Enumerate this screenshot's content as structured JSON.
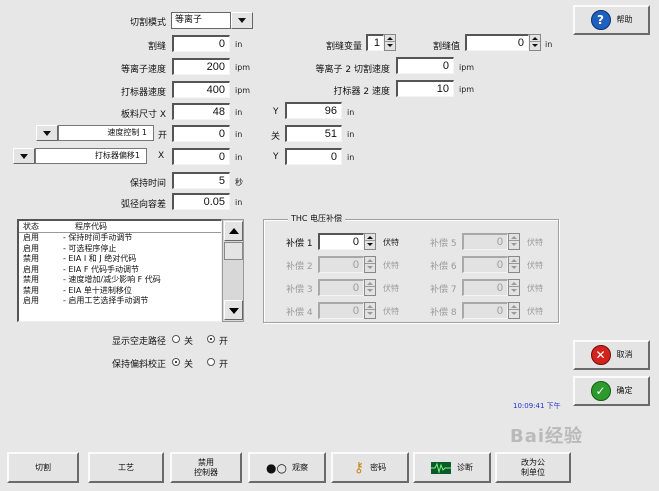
{
  "cut_mode": {
    "label": "切割模式",
    "value": "等离子"
  },
  "fields_left": [
    {
      "label": "割缝",
      "value": "0",
      "unit": "in"
    },
    {
      "label": "等离子速度",
      "value": "200",
      "unit": "ipm"
    },
    {
      "label": "打标器速度",
      "value": "400",
      "unit": "ipm"
    },
    {
      "label": "板料尺寸 X",
      "value": "48",
      "unit": "in"
    }
  ],
  "kerf_variable": {
    "label": "割缝变量",
    "value": "1"
  },
  "kerf_value": {
    "label": "割缝值",
    "value": "0",
    "unit": "in"
  },
  "plasma2_speed": {
    "label": "等离子 2 切割速度",
    "value": "0",
    "unit": "ipm"
  },
  "marker2_speed": {
    "label": "打标器 2 速度",
    "value": "10",
    "unit": "ipm"
  },
  "plate_y": {
    "label": "Y",
    "value": "96",
    "unit": "in"
  },
  "speed_control": {
    "label": "速度控制 1",
    "suffix": "开",
    "value": "0",
    "unit": "in",
    "right_label": "关",
    "right_value": "51",
    "right_unit": "in"
  },
  "marker_offset": {
    "label": "打标器偏移1",
    "axis": "X",
    "value": "0",
    "unit": "in",
    "right_label": "Y",
    "right_value": "0",
    "right_unit": "in"
  },
  "hold_time": {
    "label": "保持时间",
    "value": "5",
    "unit": "秒"
  },
  "arc_tolerance": {
    "label": "弧径向容差",
    "value": "0.05",
    "unit": "in"
  },
  "code_list": {
    "col_status": "状态",
    "col_code": "程序代码",
    "rows": [
      {
        "status": "启用",
        "code": "- 保持时间手动调节"
      },
      {
        "status": "启用",
        "code": "- 可选程序停止"
      },
      {
        "status": "禁用",
        "code": "- EIA I 和 J 绝对代码"
      },
      {
        "status": "启用",
        "code": "- EIA F 代码手动调节"
      },
      {
        "status": "禁用",
        "code": "- 速度增加/减少影响 F 代码"
      },
      {
        "status": "禁用",
        "code": "- EIA 单十进制移位"
      },
      {
        "status": "启用",
        "code": "- 启用工艺选择手动调节"
      }
    ]
  },
  "thc": {
    "title": "THC 电压补偿",
    "unit": "伏特",
    "items": [
      {
        "label": "补偿 1",
        "value": "0"
      },
      {
        "label": "补偿 2",
        "value": "0"
      },
      {
        "label": "补偿 3",
        "value": "0"
      },
      {
        "label": "补偿 4",
        "value": "0"
      },
      {
        "label": "补偿 5",
        "value": "0"
      },
      {
        "label": "补偿 6",
        "value": "0"
      },
      {
        "label": "补偿 7",
        "value": "0"
      },
      {
        "label": "补偿 8",
        "value": "0"
      }
    ]
  },
  "show_dry_path": {
    "label": "显示空走路径",
    "off": "关",
    "on": "开",
    "selected": "on"
  },
  "keep_skew": {
    "label": "保持偏斜校正",
    "off": "关",
    "on": "开",
    "selected": "off"
  },
  "help_button": "帮助",
  "cancel_button": "取消",
  "ok_button": "确定",
  "clock": "10:09:41 下午",
  "bottom_buttons": [
    "切割",
    "工艺",
    "禁用\n控制器",
    "观察",
    "密码",
    "诊断",
    "改为公\n制单位"
  ],
  "watermark": "Bai经验",
  "colors": {
    "help_blue": "#1f5fbf",
    "cancel_red": "#d2231c",
    "ok_green": "#2c9a2c",
    "clock_blue": "#2233cc"
  }
}
